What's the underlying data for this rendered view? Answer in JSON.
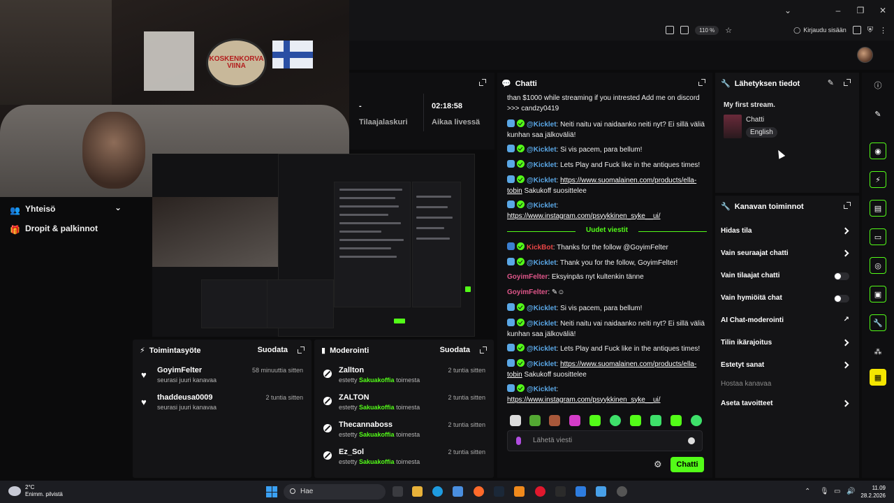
{
  "browser": {
    "zoom": "110 %",
    "login_label": "Kirjaudu sisään"
  },
  "webcam": {
    "poster_text": "KOSKENKORVA VIINA"
  },
  "left_nav": {
    "items": [
      {
        "label": "Yhteisö",
        "icon": "community-icon"
      },
      {
        "label": "Dropit & palkinnot",
        "icon": "drops-icon"
      }
    ]
  },
  "stats": {
    "subs_value": "-",
    "subs_label": "Tilaajalaskuri",
    "time_value": "02:18:58",
    "time_label": "Aikaa livessä"
  },
  "activity_feed": {
    "title": "Toimintasyöte",
    "filter": "Suodata",
    "items": [
      {
        "name": "GoyimFelter",
        "sub": "seurasi juuri kanavaa",
        "time": "58 minuuttia sitten"
      },
      {
        "name": "thaddeusa0009",
        "sub": "seurasi juuri kanavaa",
        "time": "2 tuntia sitten"
      }
    ]
  },
  "moderation": {
    "title": "Moderointi",
    "filter": "Suodata",
    "ban_prefix": "estetty",
    "ban_by": "Sakuakoffia",
    "ban_suffix": "toimesta",
    "items": [
      {
        "name": "Zallton",
        "time": "2 tuntia sitten"
      },
      {
        "name": "ZALTON",
        "time": "2 tuntia sitten"
      },
      {
        "name": "Thecannaboss",
        "time": "2 tuntia sitten"
      },
      {
        "name": "Ez_Sol",
        "time": "2 tuntia sitten"
      }
    ]
  },
  "chat": {
    "title": "Chatti",
    "new_messages": "Uudet viestit",
    "placeholder": "Lähetä viesti",
    "send_label": "Chatti",
    "messages": [
      {
        "user": "",
        "text": "than $1000 while streaming if you intrested Add me on discord >>> candzy0419"
      },
      {
        "user": "@Kicklet",
        "text": ": Neiti naitu vai naidaanko neiti nyt? Ei sillä väliä kunhan saa jälkoväliä!"
      },
      {
        "user": "@Kicklet",
        "text": ": Si vis pacem, para bellum!"
      },
      {
        "user": "@Kicklet",
        "text": ": Lets Play and Fuck like in the antiques times!"
      },
      {
        "user": "@Kicklet",
        "link": "https://www.suomalainen.com/products/ella-tobin",
        "text": " Sakukoff suosittelee"
      },
      {
        "user": "@Kicklet",
        "link": "https://www.instagram.com/psyykkinen_syke__ui/",
        "text": ""
      },
      {
        "user": "KickBot",
        "text": ": Thanks for the follow @GoyimFelter"
      },
      {
        "user": "@Kicklet",
        "text": ": Thank you for the follow, GoyimFelter!"
      },
      {
        "user": "GoyimFelter",
        "text": ": Eksyinpäs nyt kultenkin tänne"
      },
      {
        "user": "GoyimFelter",
        "text": ":"
      },
      {
        "user": "@Kicklet",
        "text": ": Si vis pacem, para bellum!"
      },
      {
        "user": "@Kicklet",
        "text": ": Neiti naitu vai naidaanko neiti nyt? Ei sillä väliä kunhan saa jälkoväliä!"
      },
      {
        "user": "@Kicklet",
        "text": ": Lets Play and Fuck like in the antiques times!"
      },
      {
        "user": "@Kicklet",
        "link": "https://www.suomalainen.com/products/ella-tobin",
        "text": " Sakukoff suosittelee"
      },
      {
        "user": "@Kicklet",
        "link": "https://www.instagram.com/psyykkinen_syke__ui/",
        "text": ""
      }
    ]
  },
  "stream_info": {
    "title": "Lähetyksen tiedot",
    "stream_title": "My first stream.",
    "category": "Chatti",
    "language": "English"
  },
  "channel_actions": {
    "title": "Kanavan toiminnot",
    "items": [
      {
        "label": "Hidas tila",
        "control": "chevron"
      },
      {
        "label": "Vain seuraajat chatti",
        "control": "chevron"
      },
      {
        "label": "Vain tilaajat chatti",
        "control": "toggle"
      },
      {
        "label": "Vain hymiöitä chat",
        "control": "toggle"
      },
      {
        "label": "AI Chat-moderointi",
        "control": "external"
      },
      {
        "label": "Tilin ikärajoitus",
        "control": "chevron"
      },
      {
        "label": "Estetyt sanat",
        "control": "chevron"
      },
      {
        "label": "Hostaa kanavaa",
        "control": "none"
      },
      {
        "label": "Aseta tavoitteet",
        "control": "chevron"
      }
    ]
  },
  "taskbar": {
    "temp": "2°C",
    "weather": "Enimm. pilvistä",
    "search": "Hae",
    "time": "11.09",
    "date": "28.2.2026"
  },
  "colors": {
    "accent": "#53fc18",
    "kickbot": "#e84545",
    "goyim": "#e0568a"
  }
}
